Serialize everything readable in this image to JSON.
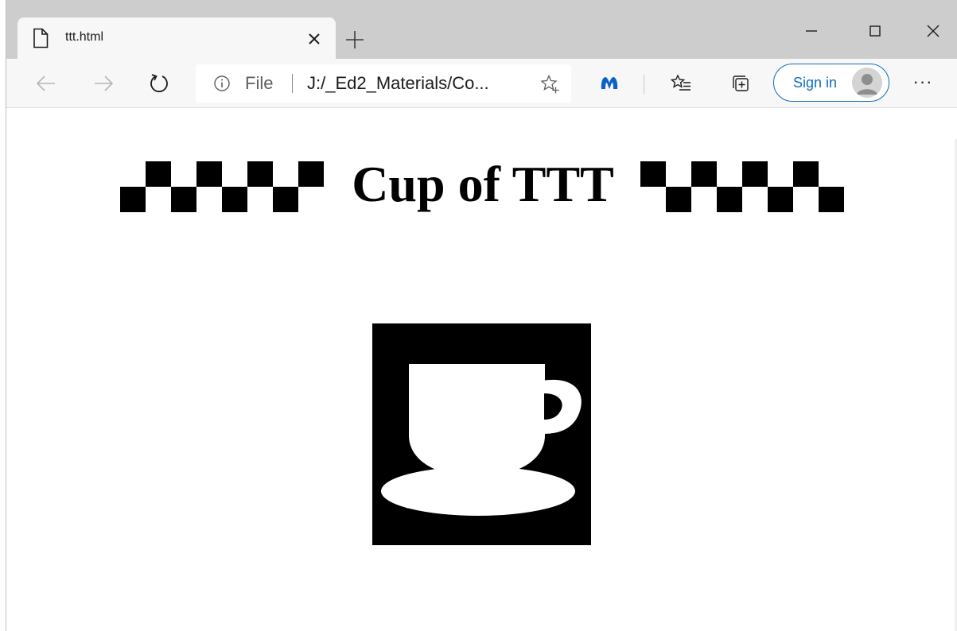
{
  "browser": {
    "tab_title": "ttt.html",
    "address": {
      "scheme_label": "File",
      "url": "J:/_Ed2_Materials/Co..."
    },
    "signin_label": "Sign in",
    "more_label": "···"
  },
  "page": {
    "heading": "Cup of TTT"
  },
  "colors": {
    "accent": "#0f6cbd",
    "tabstrip": "#cdcdcd",
    "toolbar": "#f7f7f7"
  }
}
